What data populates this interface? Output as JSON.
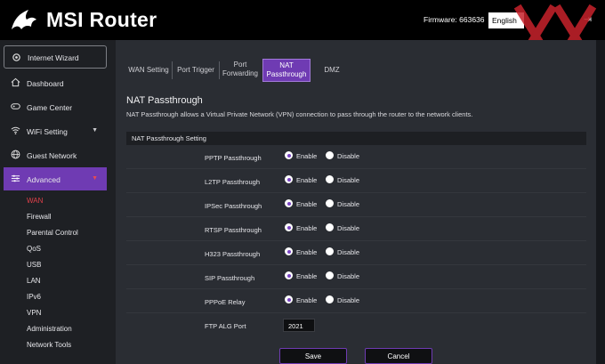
{
  "header": {
    "brand": "MSI Router",
    "firmware_label": "Firmware: 663636",
    "language": "English",
    "logout_glyph": "⇥"
  },
  "sidebar": {
    "wizard_label": "Internet Wizard",
    "items": [
      {
        "label": "Dashboard",
        "icon": "home-icon"
      },
      {
        "label": "Game Center",
        "icon": "gamepad-icon"
      },
      {
        "label": "WiFi Setting",
        "icon": "wifi-icon"
      },
      {
        "label": "Guest Network",
        "icon": "globe-icon"
      },
      {
        "label": "Advanced",
        "icon": "sliders-icon"
      }
    ],
    "advanced_sub": [
      "WAN",
      "Firewall",
      "Parental Control",
      "QoS",
      "USB",
      "LAN",
      "IPv6",
      "VPN",
      "Administration",
      "Network Tools"
    ]
  },
  "tabs": [
    {
      "label": "WAN Setting"
    },
    {
      "label": "Port Trigger"
    },
    {
      "label_line1": "Port",
      "label_line2": "Forwarding"
    },
    {
      "label_line1": "NAT",
      "label_line2": "Passthrough"
    },
    {
      "label": "DMZ"
    }
  ],
  "page": {
    "title": "NAT Passthrough",
    "description": "NAT Passthrough allows a Virtual Private Network (VPN) connection to pass through the router to the network clients.",
    "section_title": "NAT Passthrough Setting"
  },
  "settings": {
    "enable_label": "Enable",
    "disable_label": "Disable",
    "rows": [
      {
        "name": "PPTP Passthrough",
        "value": "Enable"
      },
      {
        "name": "L2TP Passthrough",
        "value": "Enable"
      },
      {
        "name": "IPSec Passthrough",
        "value": "Enable"
      },
      {
        "name": "RTSP Passthrough",
        "value": "Enable"
      },
      {
        "name": "H323 Passthrough",
        "value": "Enable"
      },
      {
        "name": "SIP Passthrough",
        "value": "Enable"
      },
      {
        "name": "PPPoE Relay",
        "value": "Enable"
      }
    ],
    "ftp_label": "FTP ALG Port",
    "ftp_value": "2021"
  },
  "buttons": {
    "save": "Save",
    "cancel": "Cancel"
  },
  "colors": {
    "accent": "#6f3bb3",
    "active_sub": "#e0404a",
    "watermark": "#c8232c"
  }
}
